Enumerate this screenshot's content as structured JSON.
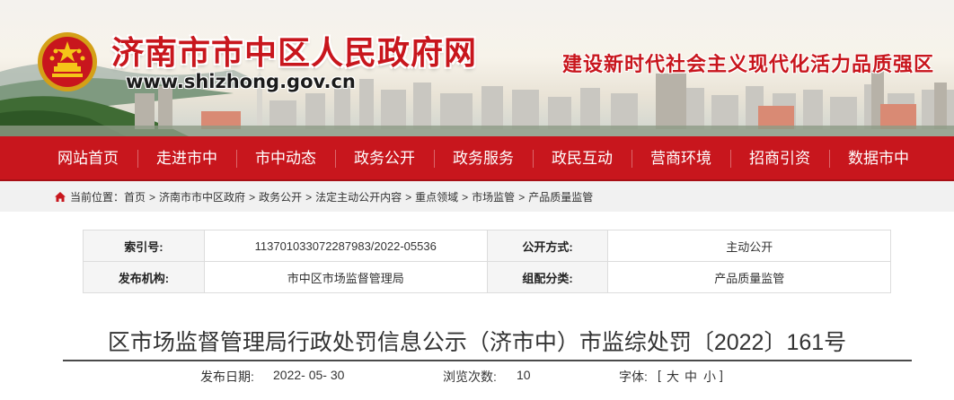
{
  "header": {
    "site_title": "济南市市中区人民政府网",
    "site_url": "www.shizhong.gov.cn",
    "slogan": "建设新时代社会主义现代化活力品质强区",
    "emblem_icon": "national-emblem-icon",
    "accent_color": "#c8161d"
  },
  "nav": {
    "items": [
      {
        "label": "网站首页"
      },
      {
        "label": "走进市中"
      },
      {
        "label": "市中动态"
      },
      {
        "label": "政务公开"
      },
      {
        "label": "政务服务"
      },
      {
        "label": "政民互动"
      },
      {
        "label": "营商环境"
      },
      {
        "label": "招商引资"
      },
      {
        "label": "数据市中"
      }
    ]
  },
  "breadcrumb": {
    "icon": "home-icon",
    "prefix": "当前位置：",
    "separator": ">",
    "items": [
      "首页",
      "济南市市中区政府",
      "政务公开",
      "法定主动公开内容",
      "重点领域",
      "市场监管",
      "产品质量监管"
    ]
  },
  "info_table": {
    "index_label": "索引号:",
    "index_value": "113701033072287983/2022-05536",
    "mode_label": "公开方式:",
    "mode_value": "主动公开",
    "publisher_label": "发布机构:",
    "publisher_value": "市中区市场监督管理局",
    "category_label": "组配分类:",
    "category_value": "产品质量监管"
  },
  "article": {
    "title": "区市场监督管理局行政处罚信息公示（济市中）市监综处罚〔2022〕161号",
    "date_label": "发布日期:",
    "date_value": "2022- 05- 30",
    "views_label": "浏览次数:",
    "views_value": "10",
    "fontsize_label": "字体:",
    "fontsize_open": "[",
    "fontsize_large": "大",
    "fontsize_medium": "中",
    "fontsize_small": "小",
    "fontsize_close": "]"
  }
}
